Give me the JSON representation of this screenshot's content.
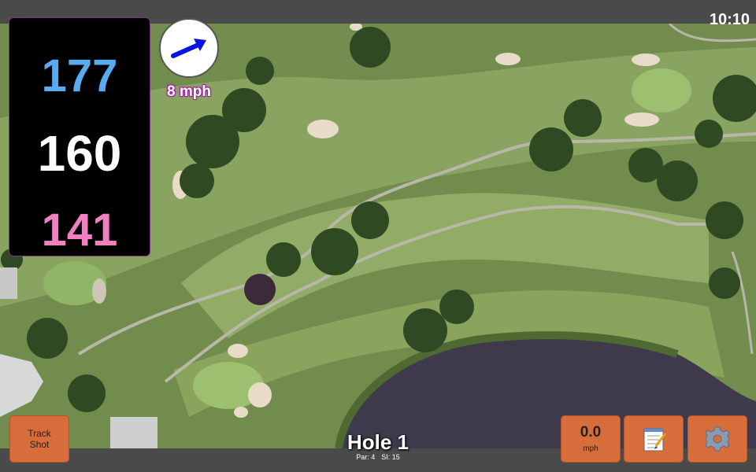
{
  "status": {
    "time": "10:10"
  },
  "distances": {
    "back": "177",
    "center": "160",
    "front": "141"
  },
  "wind": {
    "speed": "8 mph",
    "icon": "wind-arrow-icon"
  },
  "track_button": {
    "line1": "Track",
    "line2": "Shot"
  },
  "hole": {
    "title": "Hole 1",
    "par": "Par: 4",
    "si": "SI: 15"
  },
  "speed_button": {
    "value": "0.0",
    "unit": "mph"
  },
  "notes_button": {
    "icon": "notepad-icon"
  },
  "settings_button": {
    "icon": "gear-icon"
  },
  "colors": {
    "back": "#5aaaf0",
    "center": "#ffffff",
    "front": "#f080c0",
    "button": "#d86d3c",
    "wind_arrow": "#0a14e0"
  }
}
